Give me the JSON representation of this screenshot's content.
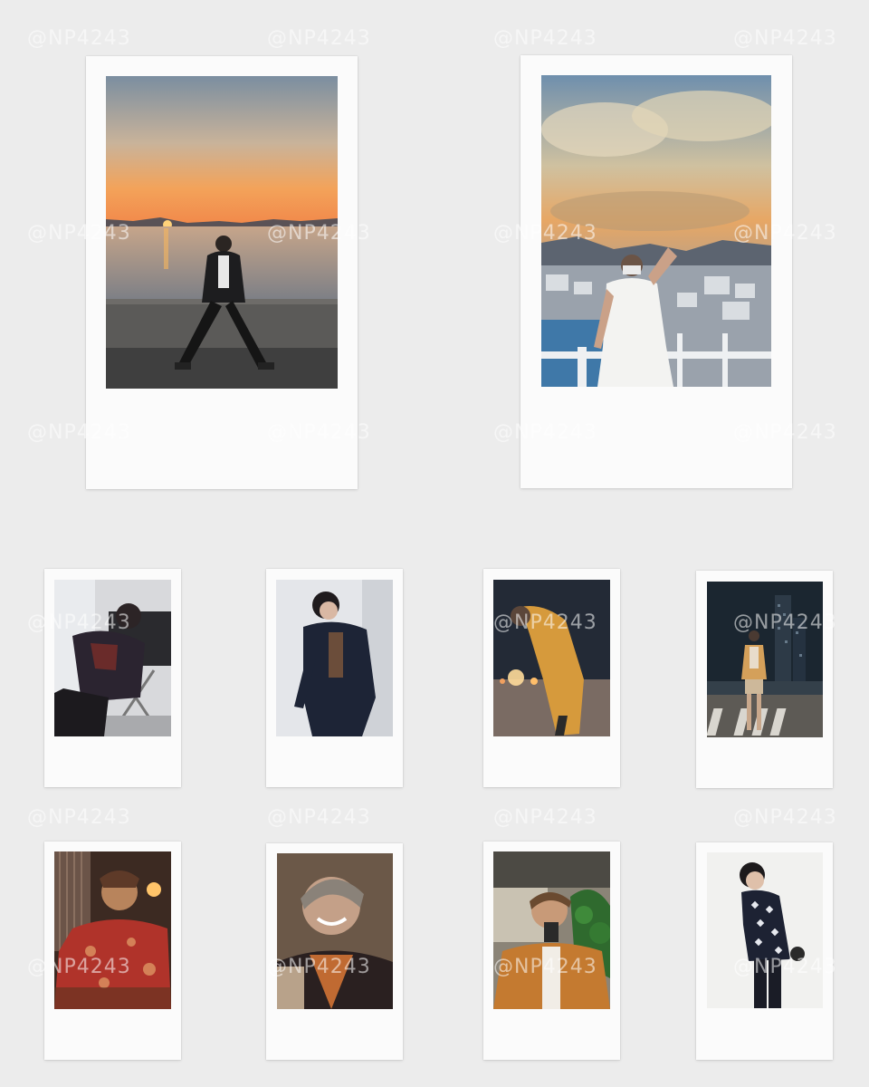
{
  "watermark": "@NP4243",
  "colors": {
    "background": "#ececec",
    "frame": "#fbfbfb"
  },
  "photos": [
    {
      "name": "sunset-seawall",
      "scene": "person sitting on a seawall at sunset over the sea"
    },
    {
      "name": "sunset-rooftop",
      "scene": "person in white t-shirt and mask on a rooftop at sunset over a town"
    },
    {
      "name": "studio-chair",
      "scene": "person reclining in a folding chair in a studio"
    },
    {
      "name": "studio-dark-suit",
      "scene": "person in dark suit against a white wall"
    },
    {
      "name": "night-street-orange",
      "scene": "person in orange jacket leaning forward on a street at night"
    },
    {
      "name": "night-city-crosswalk",
      "scene": "person standing on a crosswalk with a city skyline at night"
    },
    {
      "name": "warm-room-red-shirt",
      "scene": "person in red floral shirt in a warm lit room"
    },
    {
      "name": "smiling-portrait",
      "scene": "smiling person in an orange shirt close-up"
    },
    {
      "name": "cafe-cup",
      "scene": "person holding a paper cup in a cafe"
    },
    {
      "name": "patterned-sweater",
      "scene": "person in a patterned sweater against a white background"
    }
  ]
}
